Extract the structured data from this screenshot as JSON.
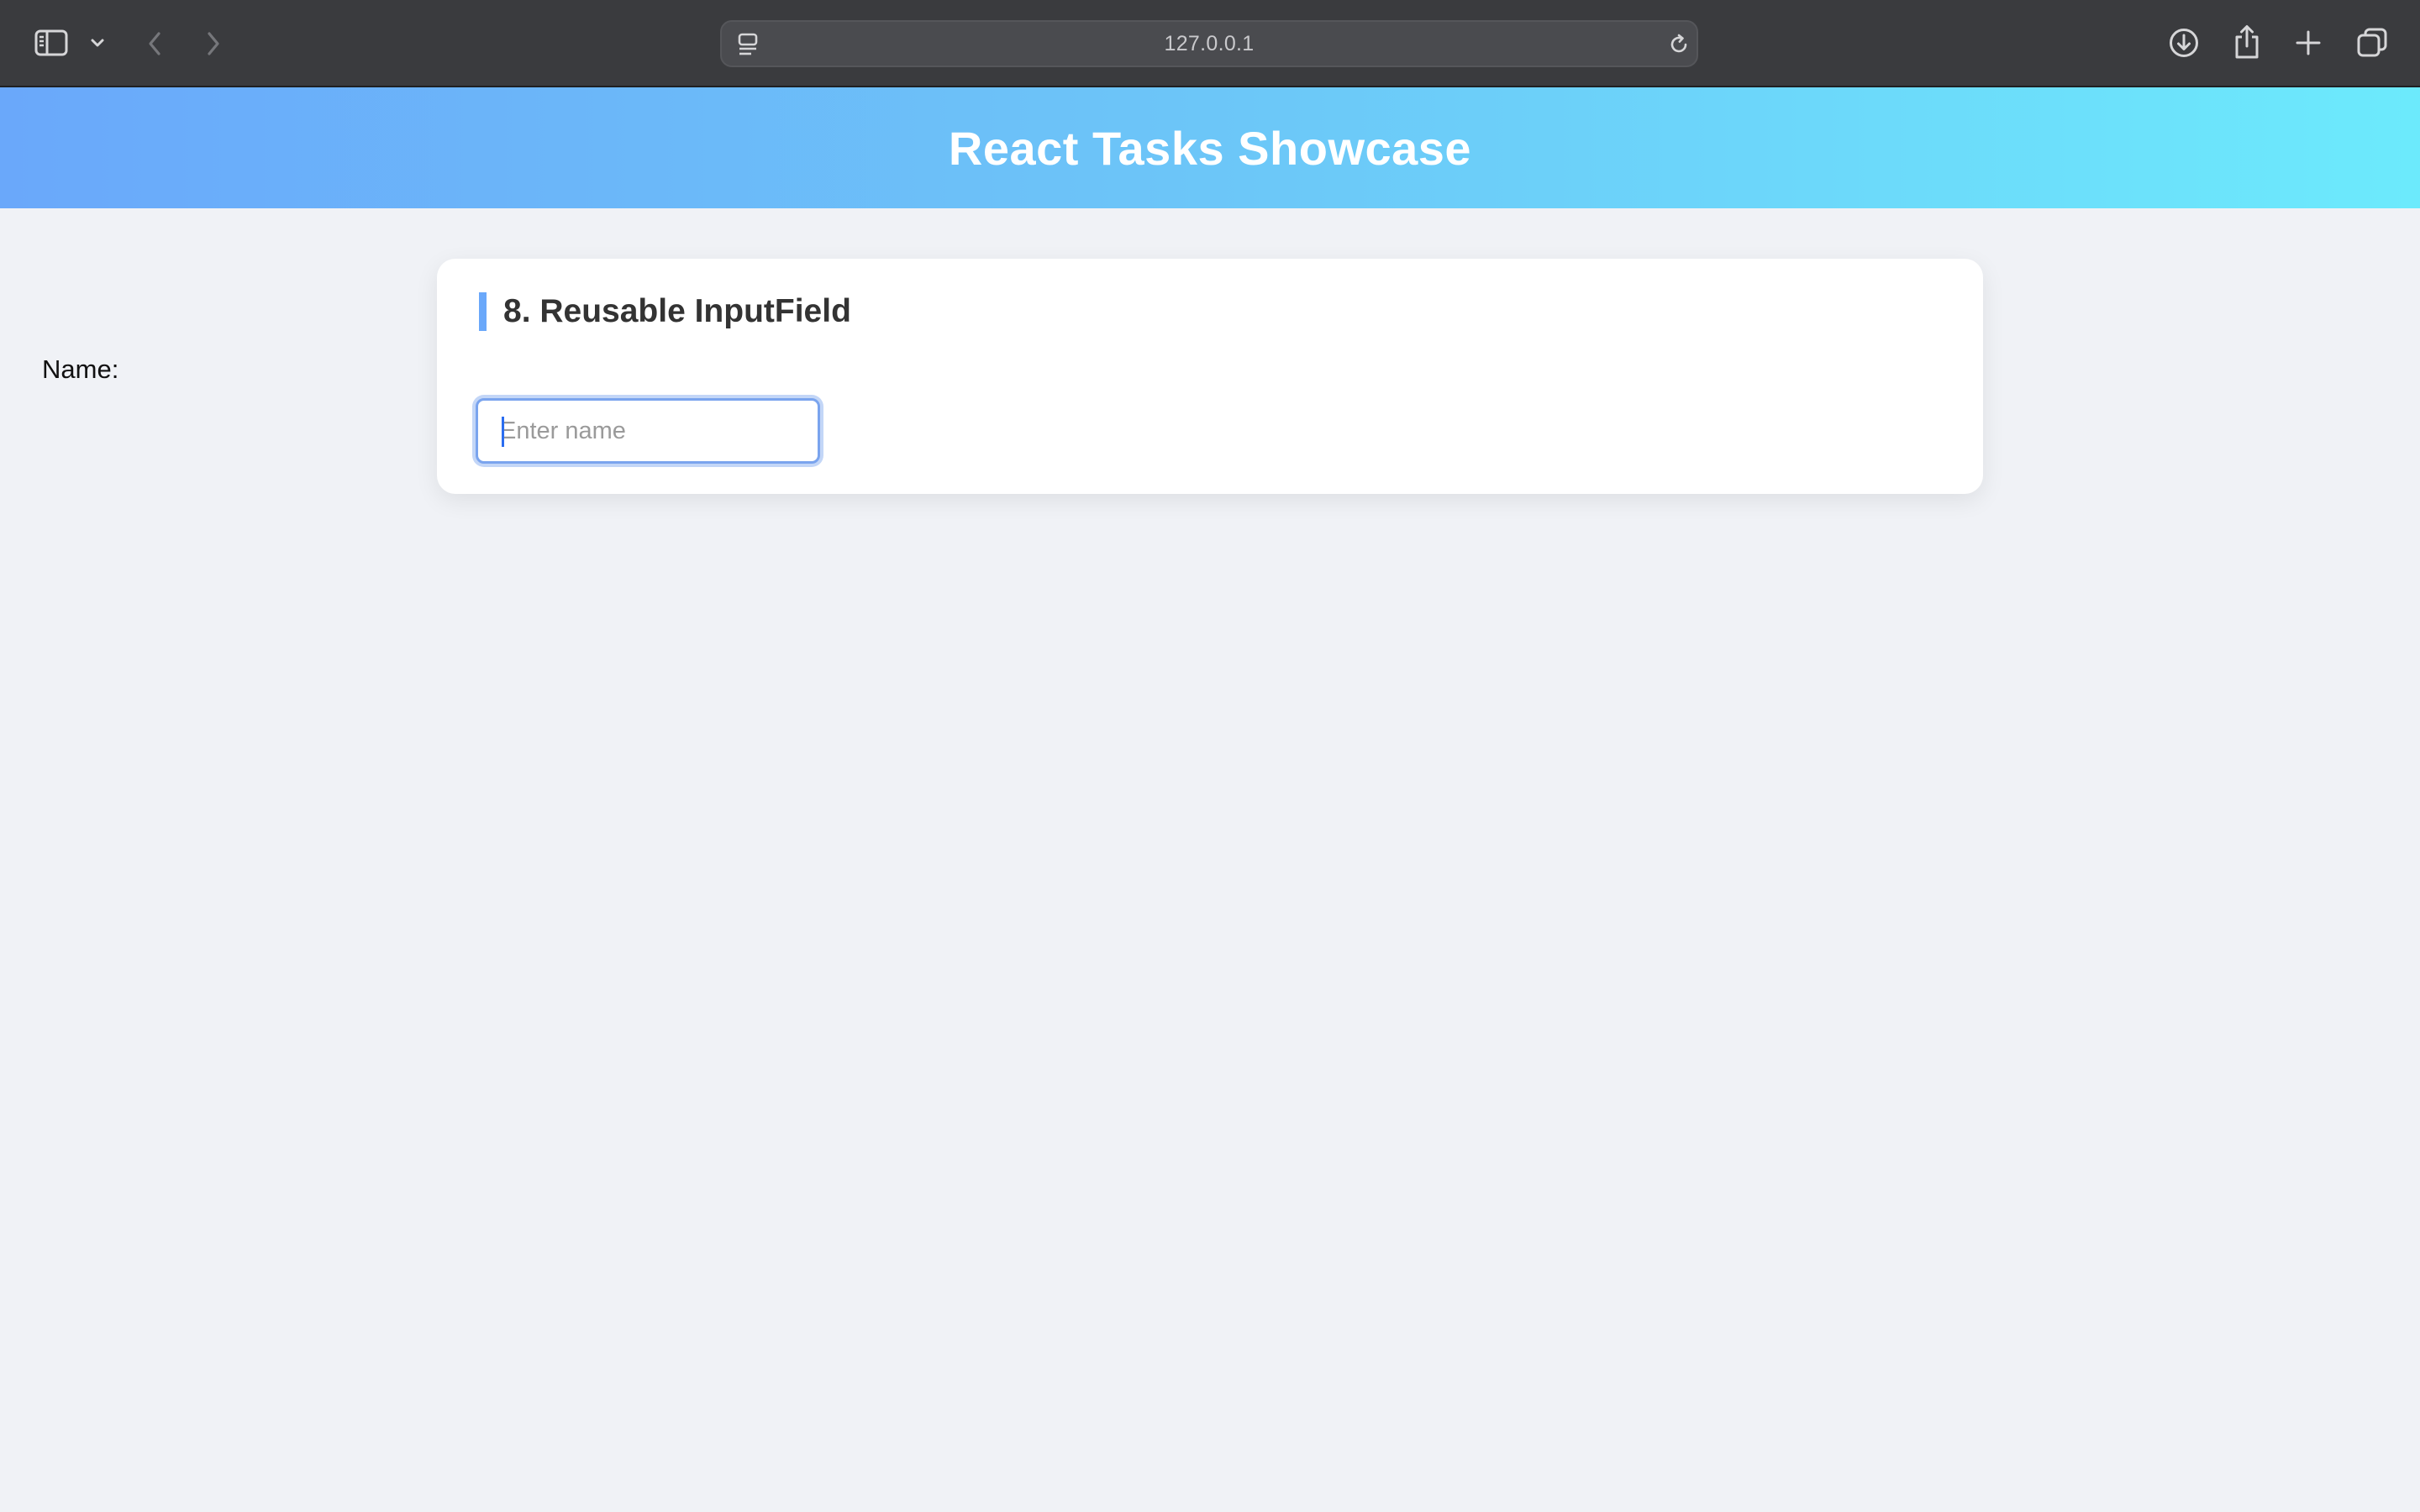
{
  "browser": {
    "url": "127.0.0.1",
    "icons": {
      "sidebar": "sidebar-icon",
      "sidebar_menu": "chevron-down-icon",
      "back": "chevron-left-icon",
      "forward": "chevron-right-icon",
      "page_menu": "page-menu-icon",
      "reload": "reload-icon",
      "downloads": "download-icon",
      "share": "share-icon",
      "new_tab": "plus-icon",
      "tabs_overview": "tabs-overview-icon"
    }
  },
  "header": {
    "title": "React Tasks Showcase",
    "gradient_start": "#6aa8fa",
    "gradient_end": "#6ceafc"
  },
  "card": {
    "title": "8. Reusable InputField",
    "accent_color": "#6aa8fa",
    "field": {
      "label": "Name:",
      "value": "",
      "placeholder": "Enter name"
    }
  }
}
